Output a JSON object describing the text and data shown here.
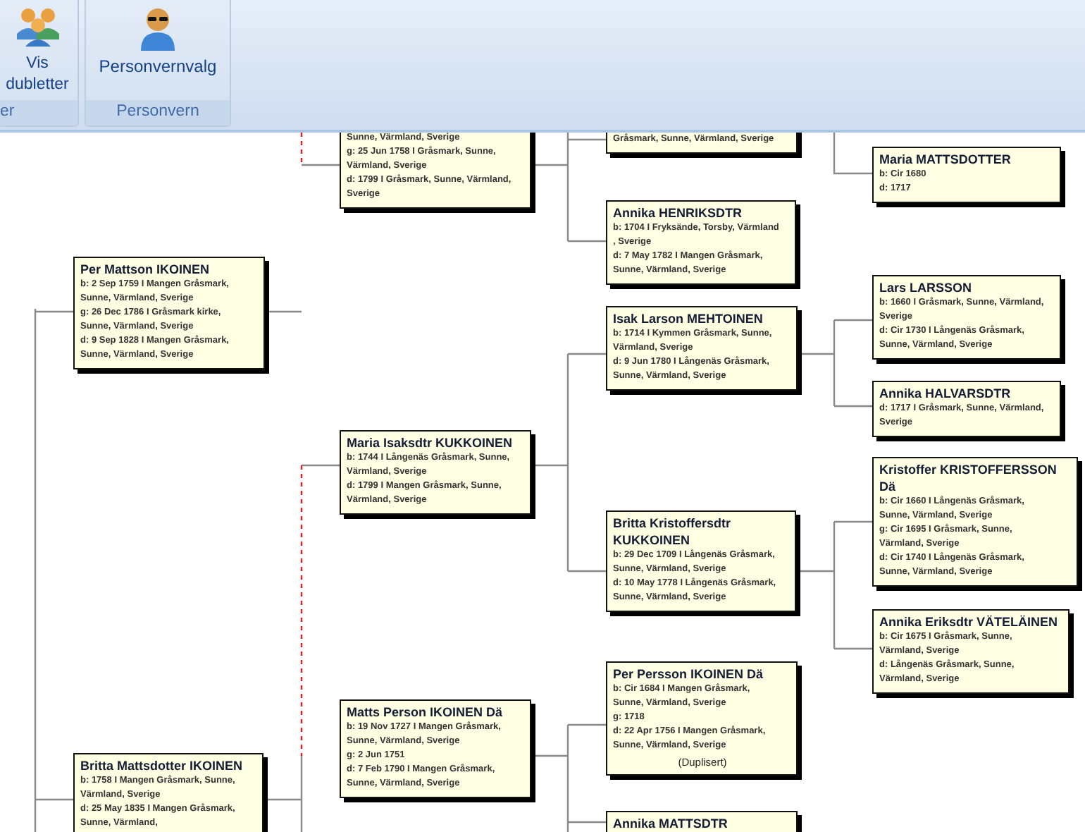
{
  "ribbon": {
    "groups": [
      {
        "label": "er",
        "buttons": [
          {
            "label": "Vis dubletter"
          }
        ]
      },
      {
        "label": "Personvern",
        "buttons": [
          {
            "label": "Personvernvalg"
          }
        ]
      }
    ]
  },
  "tree": {
    "cards": [
      {
        "facts": [
          "Sunne, Värmland, Sverige",
          "g: 25 Jun 1758 I Gråsmark, Sunne, Värmland, Sverige",
          "d: 1799 I Gråsmark, Sunne, Värmland, Sverige"
        ]
      },
      {
        "name": "Per Mattson IKOINEN",
        "facts": [
          "b: 2 Sep 1759 I Mangen Gråsmark, Sunne, Värmland, Sverige",
          "g: 26 Dec 1786 I Gråsmark kirke, Sunne, Värmland, Sverige",
          "d: 9 Sep 1828 I Mangen Gråsmark, Sunne, Värmland, Sverige"
        ]
      },
      {
        "facts": [
          "Gråsmark, Sunne, Värmland, Sverige"
        ]
      },
      {
        "name": "Annika HENRIKSDTR",
        "facts": [
          "b: 1704 I Fryksände, Torsby, Värmland , Sverige",
          "d: 7 May 1782 I Mangen Gråsmark, Sunne, Värmland, Sverige"
        ]
      },
      {
        "name": "Maria MATTSDOTTER",
        "facts": [
          "b: Cir 1680",
          "d: 1717"
        ]
      },
      {
        "name": "Lars LARSSON",
        "facts": [
          "b: 1660 I Gråsmark, Sunne, Värmland, Sverige",
          "d: Cir 1730 I Långenäs Gråsmark, Sunne, Värmland, Sverige"
        ]
      },
      {
        "name": "Isak Larson MEHTOINEN",
        "facts": [
          "b: 1714 I Kymmen Gråsmark, Sunne, Värmland, Sverige",
          "d: 9 Jun 1780 I Långenäs Gråsmark, Sunne, Värmland, Sverige"
        ]
      },
      {
        "name": "Annika HALVARSDTR",
        "facts": [
          "d: 1717 I Gråsmark, Sunne, Värmland, Sverige"
        ]
      },
      {
        "name": "Maria Isaksdtr KUKKOINEN",
        "facts": [
          "b: 1744 I Långenäs Gråsmark, Sunne, Värmland, Sverige",
          "d: 1799 I Mangen Gråsmark, Sunne, Värmland, Sverige"
        ]
      },
      {
        "name": "Britta Kristoffersdtr KUKKOINEN",
        "facts": [
          "b: 29 Dec 1709 I Långenäs Gråsmark, Sunne, Värmland, Sverige",
          "d: 10 May 1778 I Långenäs Gråsmark, Sunne, Värmland, Sverige"
        ]
      },
      {
        "name": "Kristoffer KRISTOFFERSSON Dä",
        "facts": [
          "b: Cir 1660 I Långenäs Gråsmark, Sunne, Värmland, Sverige",
          "g: Cir 1695 I Gråsmark, Sunne, Värmland, Sverige",
          "d: Cir 1740 I Långenäs Gråsmark, Sunne, Värmland, Sverige"
        ]
      },
      {
        "name": "Annika Eriksdtr VÄTELÄINEN",
        "facts": [
          "b: Cir 1675 I Gråsmark, Sunne, Värmland, Sverige",
          "d: Långenäs Gråsmark, Sunne, Värmland, Sverige"
        ]
      },
      {
        "name": "Britta Mattsdotter IKOINEN",
        "facts": [
          "b: 1758 I Mangen Gråsmark, Sunne, Värmland, Sverige",
          "d: 25 May 1835 I Mangen Gråsmark, Sunne, Värmland,"
        ]
      },
      {
        "name": "Matts Person IKOINEN Dä",
        "facts": [
          "b: 19 Nov 1727 I Mangen Gråsmark, Sunne, Värmland, Sverige",
          "g: 2 Jun 1751",
          "d: 7 Feb 1790 I Mangen Gråsmark, Sunne, Värmland, Sverige"
        ]
      },
      {
        "name": "Per Persson IKOINEN Dä",
        "facts": [
          "b: Cir 1684 I Mangen Gråsmark, Sunne, Värmland, Sverige",
          "g: 1718",
          "d: 22 Apr 1756 I Mangen Gråsmark, Sunne, Värmland, Sverige"
        ],
        "note": "(Duplisert)"
      },
      {
        "name": "Annika MATTSDTR"
      }
    ]
  }
}
